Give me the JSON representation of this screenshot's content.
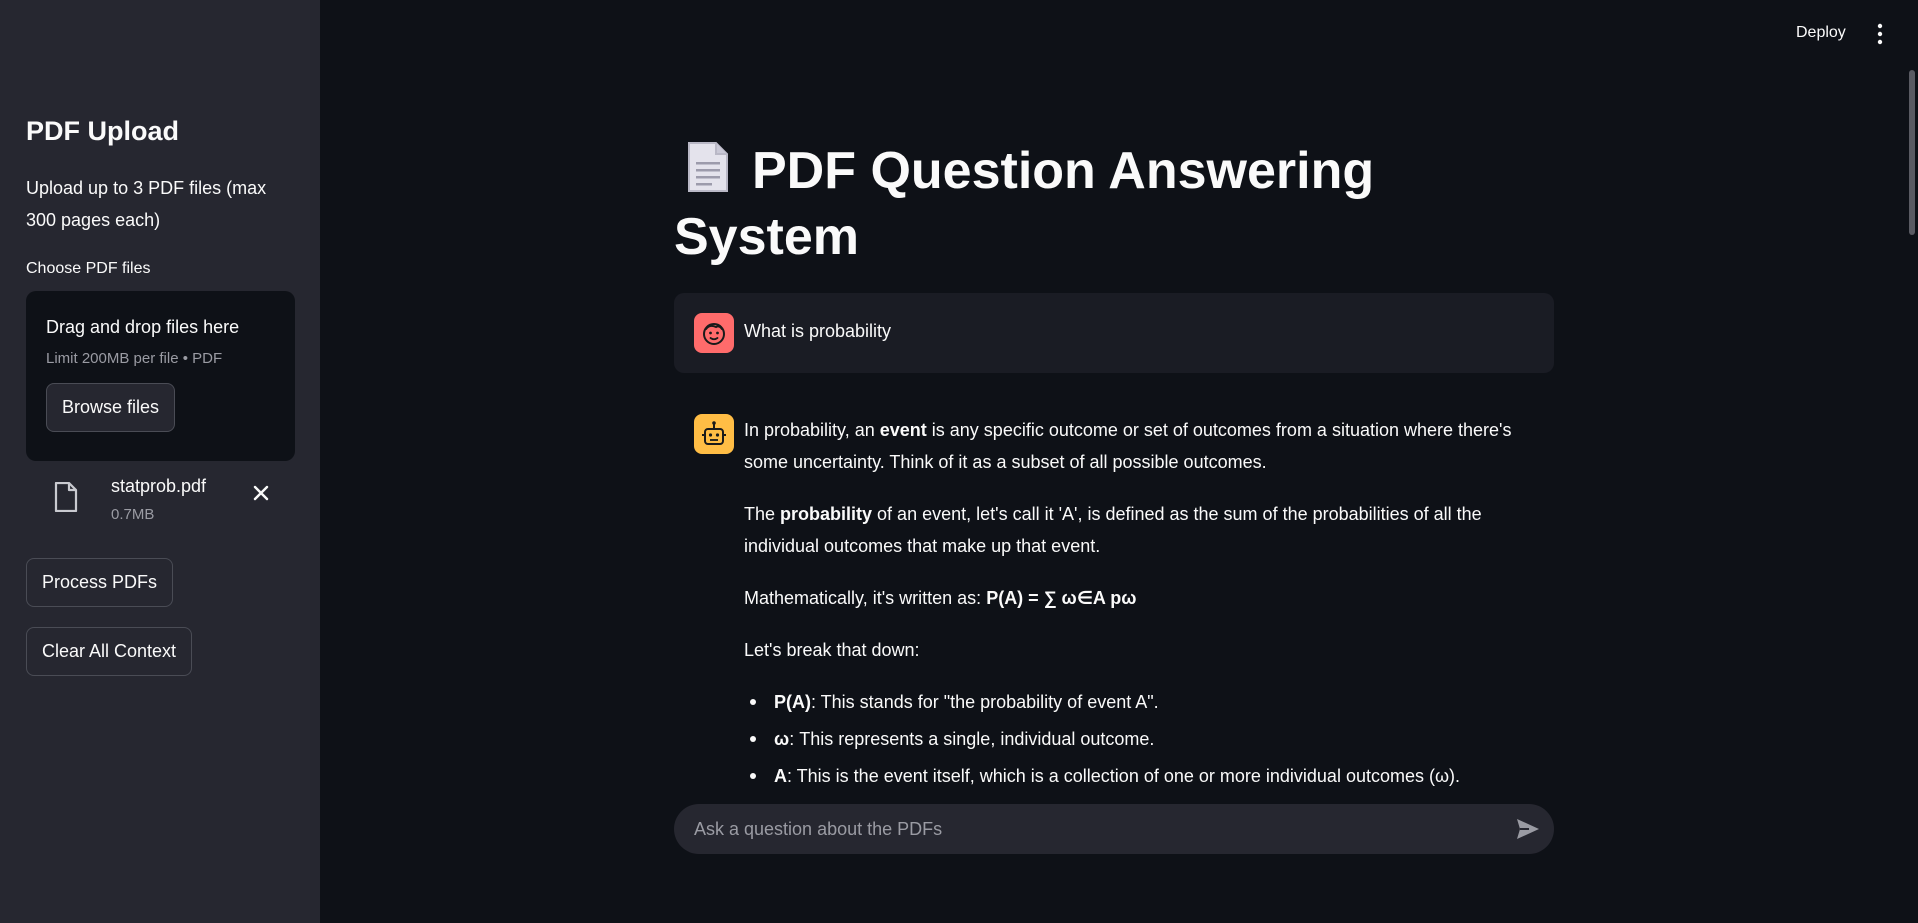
{
  "header": {
    "deploy_label": "Deploy",
    "menu_icon": "kebab-menu-icon"
  },
  "sidebar": {
    "title": "PDF Upload",
    "description": "Upload up to 3 PDF files (max 300 pages each)",
    "uploader_label": "Choose PDF files",
    "dropzone": {
      "title": "Drag and drop files here",
      "limit": "Limit 200MB per file • PDF",
      "browse_label": "Browse files"
    },
    "uploaded_file": {
      "name": "statprob.pdf",
      "size": "0.7MB",
      "icon": "file-icon",
      "remove_icon": "close-icon"
    },
    "process_label": "Process PDFs",
    "clear_label": "Clear All Context"
  },
  "main": {
    "title_emoji": "page-document-icon",
    "title": "PDF Question Answering System",
    "messages": [
      {
        "role": "user",
        "avatar": "user-face-icon",
        "text": "What is probability"
      },
      {
        "role": "assistant",
        "avatar": "robot-icon",
        "p1_a": "In probability, an ",
        "p1_b": "event",
        "p1_c": " is any specific outcome or set of outcomes from a situation where there's some uncertainty. Think of it as a subset of all possible outcomes.",
        "p2_a": "The ",
        "p2_b": "probability",
        "p2_c": " of an event, let's call it 'A', is defined as the sum of the probabilities of all the individual outcomes that make up that event.",
        "p3_a": "Mathematically, it's written as: ",
        "p3_b": "P(A) = ∑ ω∈A pω",
        "p4": "Let's break that down:",
        "bullets": [
          {
            "term": "P(A)",
            "text": ": This stands for \"the probability of event A\"."
          },
          {
            "term": "ω",
            "text": ": This represents a single, individual outcome."
          },
          {
            "term": "A",
            "text": ": This is the event itself, which is a collection of one or more individual outcomes (ω)."
          }
        ]
      }
    ],
    "chat_input": {
      "placeholder": "Ask a question about the PDFs",
      "value": "",
      "send_icon": "send-icon"
    }
  },
  "colors": {
    "background": "#0e1117",
    "sidebar": "#262730",
    "user_avatar": "#ff6b6b",
    "assistant_avatar": "#ffbd45"
  }
}
